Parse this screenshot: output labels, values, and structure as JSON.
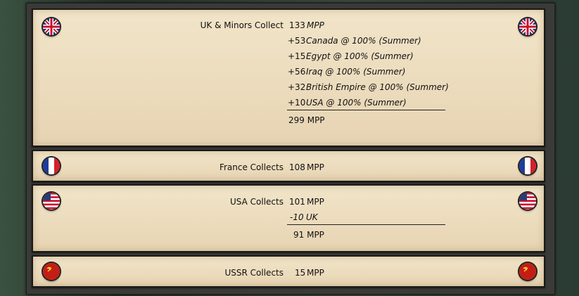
{
  "panels": {
    "uk": {
      "heading_prefix": "UK & Minors Collect",
      "heading_value": "133",
      "heading_unit": "MPP",
      "lines": [
        {
          "amount": "+53",
          "label": "Canada @ 100% (Summer)"
        },
        {
          "amount": "+15",
          "label": "Egypt @ 100% (Summer)"
        },
        {
          "amount": "+56",
          "label": "Iraq @ 100% (Summer)"
        },
        {
          "amount": "+32",
          "label": "British Empire @ 100% (Summer)"
        },
        {
          "amount": "+10",
          "label": "USA @ 100% (Summer)"
        }
      ],
      "total": "299 MPP"
    },
    "france": {
      "heading_prefix": "France Collects",
      "heading_value": "108",
      "heading_unit": "MPP"
    },
    "usa": {
      "heading_prefix": "USA Collects",
      "heading_value": "101",
      "heading_unit": "MPP",
      "lines": [
        {
          "amount": "-10",
          "label": "UK"
        }
      ],
      "total": "91 MPP"
    },
    "ussr": {
      "heading_prefix": "USSR Collects",
      "heading_value": "15",
      "heading_unit": "MPP"
    }
  },
  "icons": {
    "uk": "uk-flag-icon",
    "france": "france-flag-icon",
    "usa": "usa-flag-icon",
    "ussr": "ussr-flag-icon"
  },
  "colors": {
    "parchment": "#ecdcbd",
    "frame": "#3a3a38",
    "text": "#111111"
  }
}
